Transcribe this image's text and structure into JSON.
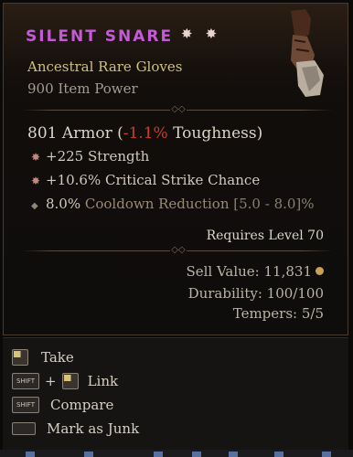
{
  "item": {
    "name": "SILENT SNARE",
    "name_stars": [
      "✸",
      "✸"
    ],
    "type": "Ancestral Rare Gloves",
    "item_power": "900 Item Power"
  },
  "armor": {
    "prefix": "801 Armor (",
    "toughness_change": "-1.1%",
    "suffix": " Toughness)"
  },
  "stats": [
    {
      "text": "+225 Strength",
      "kind": "greater"
    },
    {
      "text": "+10.6% Critical Strike Chance",
      "kind": "greater"
    },
    {
      "value": "8.0%",
      "label": "Cooldown Reduction",
      "range": "[5.0 - 8.0]%",
      "kind": "normal"
    }
  ],
  "requires": "Requires Level 70",
  "sell_value": "Sell Value: 11,831",
  "durability": "Durability: 100/100",
  "tempers": "Tempers: 5/5",
  "actions": [
    {
      "label": "Take"
    },
    {
      "label": "Link",
      "plus": "+"
    },
    {
      "label": "Compare"
    },
    {
      "label": "Mark as Junk"
    }
  ],
  "keys": {
    "shift": "SHIFT"
  },
  "colors": {
    "legendary_name": "#c45ad8",
    "rare_type": "#cfc07a",
    "negative": "#d23a2d"
  }
}
